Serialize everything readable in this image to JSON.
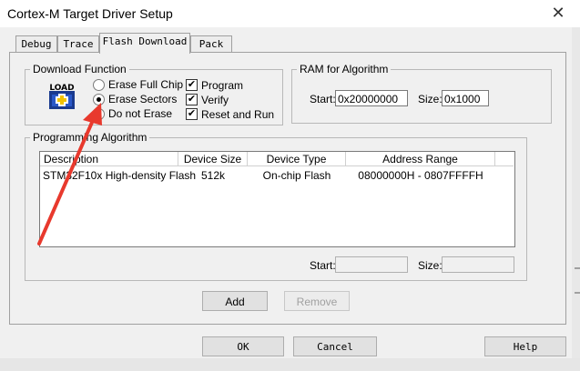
{
  "window": {
    "title": "Cortex-M Target Driver Setup"
  },
  "tabs": [
    {
      "label": "Debug"
    },
    {
      "label": "Trace"
    },
    {
      "label": "Flash Download"
    },
    {
      "label": "Pack"
    }
  ],
  "download_function": {
    "group_label": "Download Function",
    "icon_text": "LOAD",
    "erase_options": [
      {
        "label": "Erase Full Chip",
        "selected": false
      },
      {
        "label": "Erase Sectors",
        "selected": true
      },
      {
        "label": "Do not Erase",
        "selected": false
      }
    ],
    "actions": [
      {
        "label": "Program",
        "checked": true
      },
      {
        "label": "Verify",
        "checked": true
      },
      {
        "label": "Reset and Run",
        "checked": true
      }
    ]
  },
  "ram": {
    "group_label": "RAM for Algorithm",
    "start_label": "Start:",
    "start_value": "0x20000000",
    "size_label": "Size:",
    "size_value": "0x1000"
  },
  "programming_algorithm": {
    "group_label": "Programming Algorithm",
    "columns": [
      "Description",
      "Device Size",
      "Device Type",
      "Address Range"
    ],
    "rows": [
      {
        "description": "STM32F10x High-density Flash",
        "size": "512k",
        "type": "On-chip Flash",
        "range": "08000000H - 0807FFFFH"
      }
    ],
    "start_label": "Start:",
    "size_label": "Size:",
    "add_label": "Add",
    "remove_label": "Remove"
  },
  "buttons": {
    "ok": "OK",
    "cancel": "Cancel",
    "help": "Help"
  },
  "annotation": {
    "arrow_color": "#e8392d"
  }
}
